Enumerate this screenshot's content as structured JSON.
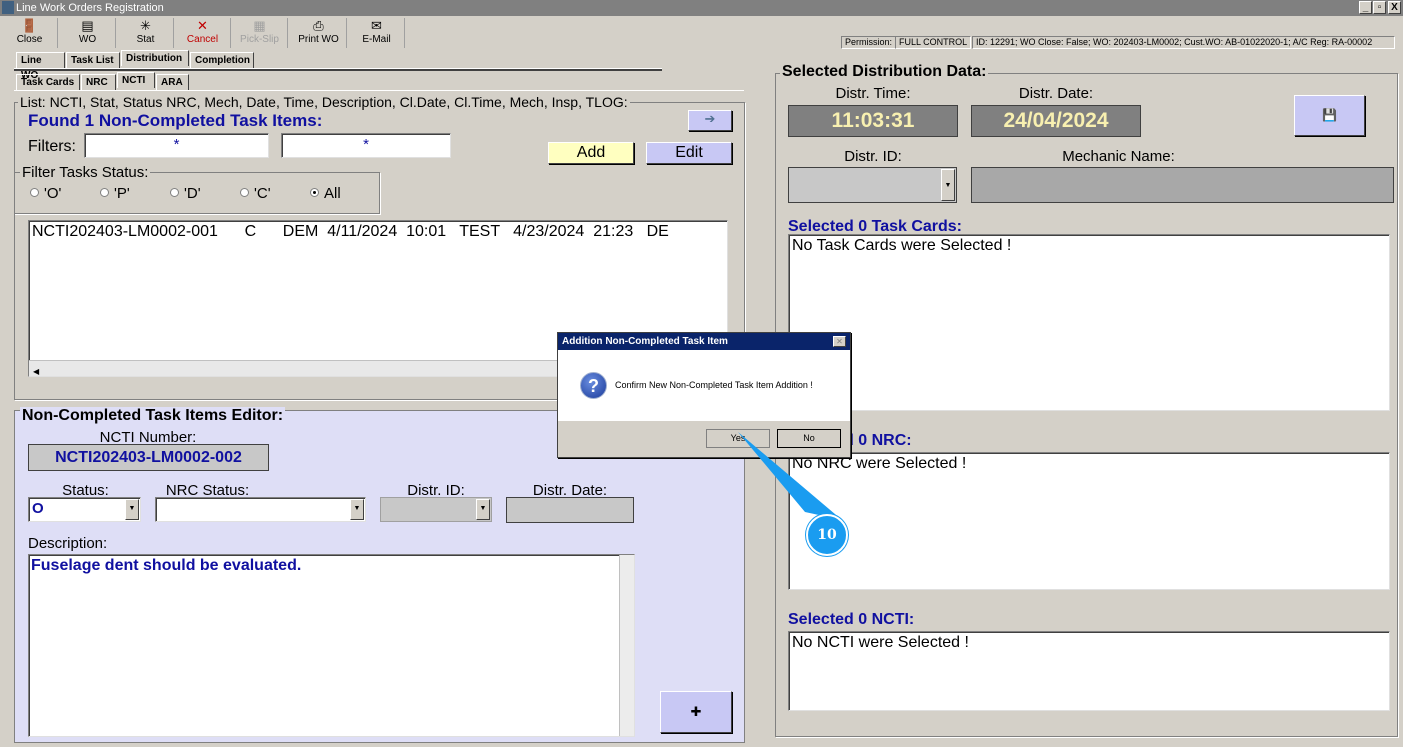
{
  "window": {
    "title": "Line Work Orders Registration",
    "min": "_",
    "restore": "▫",
    "close": "X"
  },
  "toolbar": [
    {
      "label": "Close",
      "icon": "door-exit-icon",
      "glyph": "🚪"
    },
    {
      "label": "WO",
      "icon": "wo-icon",
      "glyph": "▤"
    },
    {
      "label": "Stat",
      "icon": "stat-icon",
      "glyph": "✳"
    },
    {
      "label": "Cancel",
      "icon": "cancel-icon",
      "glyph": "✕"
    },
    {
      "label": "Pick-Slip",
      "icon": "pick-slip-icon",
      "glyph": "▦"
    },
    {
      "label": "Print WO",
      "icon": "printer-icon",
      "glyph": "⎙"
    },
    {
      "label": "E-Mail",
      "icon": "email-icon",
      "glyph": "✉"
    }
  ],
  "status": {
    "permission_label": "Permission:",
    "permission": "FULL CONTROL",
    "info": "ID: 12291; WO Close: False; WO: 202403-LM0002; Cust.WO: AB-01022020-1; A/C Reg: RA-00002"
  },
  "tabs": [
    "Line WO",
    "Task List",
    "Distribution",
    "Completion"
  ],
  "subtabs": [
    "Task Cards",
    "NRC",
    "NCTI",
    "ARA"
  ],
  "list": {
    "group_label": "List: NCTI, Stat, Status NRC, Mech, Date, Time, Description, Cl.Date, Cl.Time, Mech, Insp, TLOG:",
    "found": "Found 1 Non-Completed Task Items:",
    "filters_label": "Filters:",
    "filter1": "*",
    "filter2": "*",
    "add": "Add",
    "edit": "Edit",
    "arrow": "➔",
    "status_label": "Filter Tasks Status:",
    "radios": [
      "'O'",
      "'P'",
      "'D'",
      "'C'",
      "All"
    ],
    "rows": [
      "NCTI202403-LM0002-001      C      DEM  4/11/2024  10:01   TEST   4/23/2024  21:23   DE"
    ]
  },
  "editor": {
    "title": "Non-Completed Task Items Editor:",
    "ncti_label": "NCTI Number:",
    "ncti": "NCTI202403-LM0002-002",
    "status_label": "Status:",
    "status": "O",
    "nrc_label": "NRC Status:",
    "distr_id_label": "Distr. ID:",
    "distr_date_label": "Distr. Date:",
    "desc_label": "Description:",
    "desc": "Fuselage dent should be evaluated.",
    "plus": "✚"
  },
  "right": {
    "title": "Selected Distribution Data:",
    "time_label": "Distr. Time:",
    "time": "11:03:31",
    "date_label": "Distr. Date:",
    "date": "24/04/2024",
    "save": "💾",
    "distr_id_label": "Distr. ID:",
    "mech_label": "Mechanic Name:",
    "tc_title": "Selected 0 Task Cards:",
    "tc_text": "No Task Cards were Selected !",
    "nrc_title": "Selected 0 NRC:",
    "nrc_text": "No NRC were Selected !",
    "ncti_title": "Selected 0 NCTI:",
    "ncti_text": "No NCTI were Selected !"
  },
  "dialog": {
    "title": "Addition Non-Completed Task Item",
    "message": "Confirm New Non-Completed Task Item Addition !",
    "yes": "Yes",
    "no": "No",
    "close": "✕",
    "icon": "?"
  },
  "callout": {
    "number": "10",
    "color": "#1a9cf0"
  }
}
